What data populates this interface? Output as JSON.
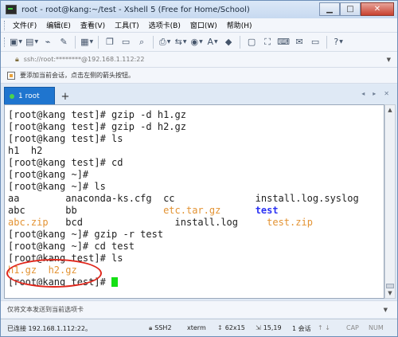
{
  "window": {
    "title": "root - root@kang:~/test - Xshell 5 (Free for Home/School)",
    "buttons": {
      "minimize": "▁",
      "maximize": "□",
      "close": "✕"
    }
  },
  "menu": [
    "文件(F)",
    "编辑(E)",
    "查看(V)",
    "工具(T)",
    "选项卡(B)",
    "窗口(W)",
    "帮助(H)"
  ],
  "toolbar": {
    "icons": [
      "new-session-icon",
      "open-folder-icon",
      "disconnect-icon",
      "edit-icon",
      "properties-icon",
      "copy-icon",
      "paste-icon",
      "find-icon",
      "print-icon",
      "transfer-icon",
      "globe-icon",
      "font-icon",
      "color-icon",
      "lock-icon",
      "fullscreen-icon",
      "keyboard-icon",
      "compose-icon",
      "message-icon",
      "help-icon"
    ]
  },
  "address": {
    "value": "ssh://root:********@192.168.1.112:22"
  },
  "infobar": {
    "text": "要添加当前会话，点击左侧的箭头按钮。"
  },
  "tabs": [
    {
      "label": "1 root",
      "active": true
    }
  ],
  "tab_add": "+",
  "tab_nav": {
    "prev": "◂",
    "next": "▸",
    "close": "✕"
  },
  "terminal": {
    "lines": [
      [
        {
          "text": "[root@kang test]# gzip -d h1.gz",
          "color": "normal"
        }
      ],
      [
        {
          "text": "[root@kang test]# gzip -d h2.gz",
          "color": "normal"
        }
      ],
      [
        {
          "text": "[root@kang test]# ls",
          "color": "normal"
        }
      ],
      [
        {
          "text": "h1  h2",
          "color": "normal"
        }
      ],
      [
        {
          "text": "[root@kang test]# cd",
          "color": "normal"
        }
      ],
      [
        {
          "text": "[root@kang ~]#",
          "color": "normal"
        }
      ],
      [
        {
          "text": "[root@kang ~]# ls",
          "color": "normal"
        }
      ],
      [
        {
          "text": "aa        anaconda-ks.cfg  cc              install.log.syslog",
          "color": "normal"
        }
      ],
      [
        {
          "text": "abc       bb               ",
          "color": "normal"
        },
        {
          "text": "etc.tar.gz",
          "color": "orange"
        },
        {
          "text": "      ",
          "color": "normal"
        },
        {
          "text": "test",
          "color": "blue"
        }
      ],
      [
        {
          "text": "abc.zip",
          "color": "orange"
        },
        {
          "text": "   bcd                install.log     ",
          "color": "normal"
        },
        {
          "text": "test.zip",
          "color": "orange"
        }
      ],
      [
        {
          "text": "[root@kang ~]# gzip -r test",
          "color": "normal"
        }
      ],
      [
        {
          "text": "[root@kang ~]# cd test",
          "color": "normal"
        }
      ],
      [
        {
          "text": "[root@kang test]# ls",
          "color": "normal"
        }
      ],
      [
        {
          "text": "h1.gz",
          "color": "orange"
        },
        {
          "text": "  ",
          "color": "normal"
        },
        {
          "text": "h2.gz",
          "color": "orange"
        }
      ],
      [
        {
          "text": "[root@kang test]# ",
          "color": "normal"
        }
      ]
    ]
  },
  "compose": {
    "placeholder": "仅将文本发送到当前选项卡"
  },
  "status": {
    "connection": "已连接 192.168.1.112:22。",
    "protocol": "SSH2",
    "terminal_type": "xterm",
    "size": "62x15",
    "position": "15,19",
    "sessions": "1 会话",
    "cap": "CAP",
    "num": "NUM"
  }
}
